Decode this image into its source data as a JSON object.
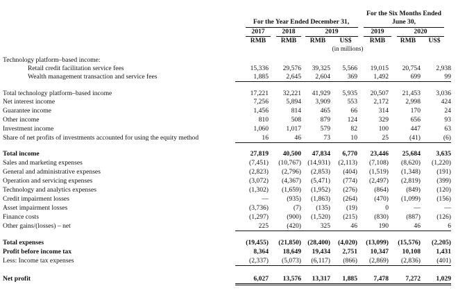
{
  "header": {
    "year_group": "For the Year Ended December 31,",
    "six_month_group_line1": "For the Six Months Ended",
    "six_month_group_line2": "June 30,",
    "year_2019_group": "2019",
    "year_2020_group": "2020",
    "columns": [
      {
        "year": "2017",
        "currency": "RMB"
      },
      {
        "year": "2018",
        "currency": "RMB"
      },
      {
        "year": "",
        "currency": "RMB"
      },
      {
        "year": "",
        "currency": "US$"
      },
      {
        "year": "2019",
        "currency": "RMB"
      },
      {
        "year": "",
        "currency": "RMB"
      },
      {
        "year": "",
        "currency": "US$"
      }
    ],
    "unit_note": "(in millions)"
  },
  "sections": [
    {
      "label": "Technology platform–based income:",
      "values": [
        "",
        "",
        "",
        "",
        "",
        "",
        ""
      ]
    },
    {
      "label": "Retail credit facilitation service fees",
      "values": [
        "15,336",
        "29,576",
        "39,325",
        "5,566",
        "19,015",
        "20,754",
        "2,938"
      ]
    },
    {
      "label": "Wealth management transaction and service fees",
      "values": [
        "1,885",
        "2,645",
        "2,604",
        "369",
        "1,492",
        "699",
        "99"
      ]
    },
    {
      "label": "Total technology platform–based income",
      "values": [
        "17,221",
        "32,221",
        "41,929",
        "5,935",
        "20,507",
        "21,453",
        "3,036"
      ]
    },
    {
      "label": "Net interest income",
      "values": [
        "7,256",
        "5,894",
        "3,909",
        "553",
        "2,172",
        "2,998",
        "424"
      ]
    },
    {
      "label": "Guarantee income",
      "values": [
        "1,456",
        "814",
        "465",
        "66",
        "314",
        "170",
        "24"
      ]
    },
    {
      "label": "Other income",
      "values": [
        "810",
        "508",
        "879",
        "124",
        "329",
        "656",
        "93"
      ]
    },
    {
      "label": "Investment income",
      "values": [
        "1,060",
        "1,017",
        "579",
        "82",
        "100",
        "447",
        "63"
      ]
    },
    {
      "label": "Share of net profits of investments accounted for using the equity method",
      "values": [
        "16",
        "46",
        "73",
        "10",
        "25",
        "(41)",
        "(6)"
      ]
    },
    {
      "label": "Total income",
      "values": [
        "27,819",
        "40,500",
        "47,834",
        "6,770",
        "23,446",
        "25,684",
        "3,635"
      ]
    },
    {
      "label": "Sales and marketing expenses",
      "values": [
        "(7,451)",
        "(10,767)",
        "(14,931)",
        "(2,113)",
        "(7,108)",
        "(8,620)",
        "(1,220)"
      ]
    },
    {
      "label": "General and administrative expenses",
      "values": [
        "(2,823)",
        "(2,796)",
        "(2,853)",
        "(404)",
        "(1,519)",
        "(1,348)",
        "(191)"
      ]
    },
    {
      "label": "Operation and servicing expenses",
      "values": [
        "(3,072)",
        "(4,367)",
        "(5,471)",
        "(774)",
        "(2,497)",
        "(2,819)",
        "(399)"
      ]
    },
    {
      "label": "Technology and analytics expenses",
      "values": [
        "(1,302)",
        "(1,659)",
        "(1,952)",
        "(276)",
        "(864)",
        "(849)",
        "(120)"
      ]
    },
    {
      "label": "Credit impairment losses",
      "values": [
        "—",
        "(935)",
        "(1,863)",
        "(264)",
        "(470)",
        "(1,099)",
        "(156)"
      ]
    },
    {
      "label": "Asset impairment losses",
      "values": [
        "(3,736)",
        "(7)",
        "(135)",
        "(19)",
        "0",
        "—",
        "—"
      ]
    },
    {
      "label": "Finance costs",
      "values": [
        "(1,297)",
        "(900)",
        "(1,520)",
        "(215)",
        "(830)",
        "(887)",
        "(126)"
      ]
    },
    {
      "label": "Other gains/(losses) – net",
      "values": [
        "225",
        "(420)",
        "325",
        "46",
        "190",
        "46",
        "6"
      ]
    },
    {
      "label": "Total expenses",
      "values": [
        "(19,455)",
        "(21,850)",
        "(28,400)",
        "(4,020)",
        "(13,099)",
        "(15,576)",
        "(2,205)"
      ]
    },
    {
      "label": "Profit before income tax",
      "values": [
        "8,364",
        "18,649",
        "19,434",
        "2,751",
        "10,347",
        "10,108",
        "1,431"
      ]
    },
    {
      "label": "Less: Income tax expenses",
      "values": [
        "(2,337)",
        "(5,073)",
        "(6,117)",
        "(866)",
        "(2,869)",
        "(2,836)",
        "(401)"
      ]
    },
    {
      "label": "Net profit",
      "values": [
        "6,027",
        "13,576",
        "13,317",
        "1,885",
        "7,478",
        "7,272",
        "1,029"
      ]
    }
  ]
}
